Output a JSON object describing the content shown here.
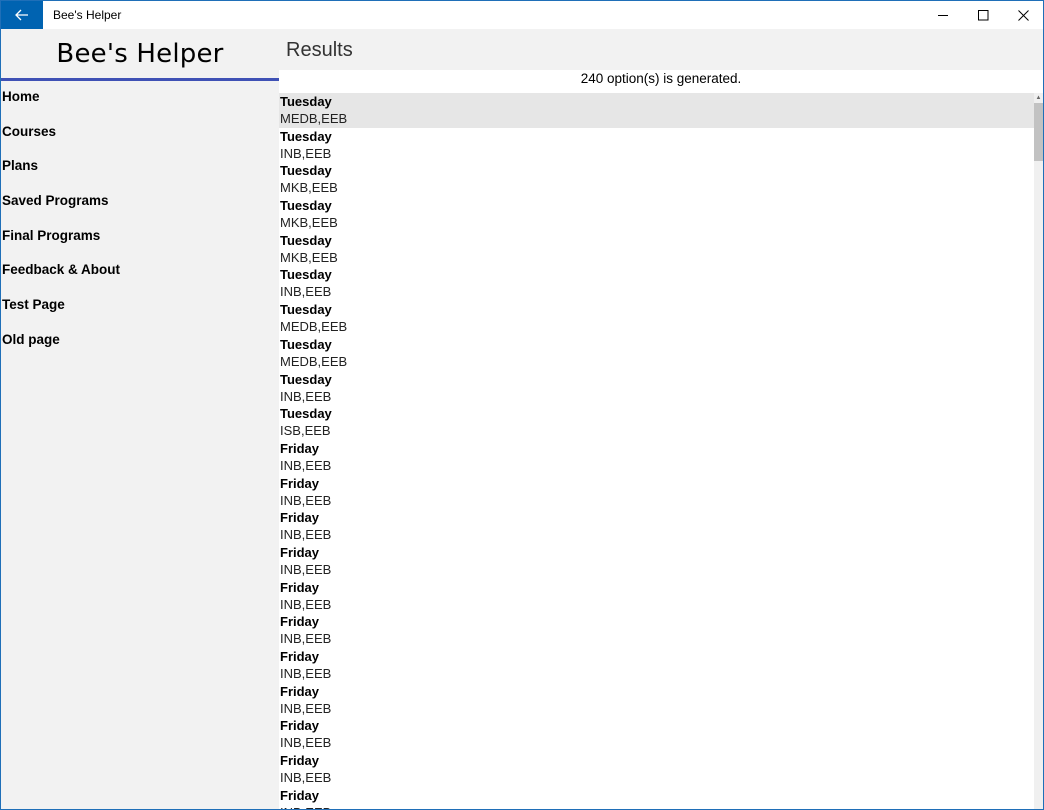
{
  "window": {
    "title": "Bee's Helper"
  },
  "sidebar": {
    "app_title": "Bee's Helper",
    "items": [
      {
        "label": "Home"
      },
      {
        "label": "Courses"
      },
      {
        "label": "Plans"
      },
      {
        "label": "Saved Programs"
      },
      {
        "label": "Final Programs"
      },
      {
        "label": "Feedback & About"
      },
      {
        "label": "Test Page"
      },
      {
        "label": "Old page"
      }
    ]
  },
  "main": {
    "title": "Results",
    "count_text": "240 option(s) is generated.",
    "results": [
      {
        "day": "Tuesday",
        "codes": "MEDB,EEB",
        "selected": true
      },
      {
        "day": "Tuesday",
        "codes": "INB,EEB"
      },
      {
        "day": "Tuesday",
        "codes": "MKB,EEB"
      },
      {
        "day": "Tuesday",
        "codes": "MKB,EEB"
      },
      {
        "day": "Tuesday",
        "codes": "MKB,EEB"
      },
      {
        "day": "Tuesday",
        "codes": "INB,EEB"
      },
      {
        "day": "Tuesday",
        "codes": "MEDB,EEB"
      },
      {
        "day": "Tuesday",
        "codes": "MEDB,EEB"
      },
      {
        "day": "Tuesday",
        "codes": "INB,EEB"
      },
      {
        "day": "Tuesday",
        "codes": "ISB,EEB"
      },
      {
        "day": "Friday",
        "codes": "INB,EEB"
      },
      {
        "day": "Friday",
        "codes": "INB,EEB"
      },
      {
        "day": "Friday",
        "codes": "INB,EEB"
      },
      {
        "day": "Friday",
        "codes": "INB,EEB"
      },
      {
        "day": "Friday",
        "codes": "INB,EEB"
      },
      {
        "day": "Friday",
        "codes": "INB,EEB"
      },
      {
        "day": "Friday",
        "codes": "INB,EEB"
      },
      {
        "day": "Friday",
        "codes": "INB,EEB"
      },
      {
        "day": "Friday",
        "codes": "INB,EEB"
      },
      {
        "day": "Friday",
        "codes": "INB,EEB"
      },
      {
        "day": "Friday",
        "codes": "INB,EEB"
      }
    ]
  }
}
